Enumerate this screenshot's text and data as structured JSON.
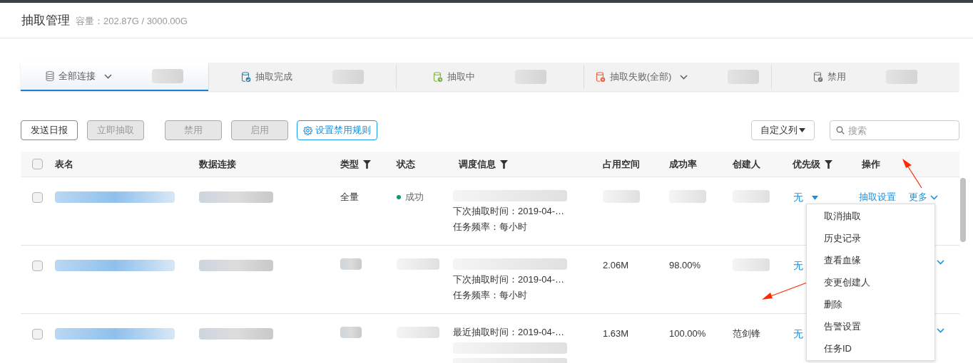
{
  "header": {
    "title": "抽取管理",
    "capacity": "容量：202.87G / 3000.00G"
  },
  "tabs": [
    {
      "label": "全部连接",
      "kind": "all",
      "dropdown": true,
      "selected": true
    },
    {
      "label": "抽取完成",
      "kind": "done",
      "dropdown": false,
      "selected": false
    },
    {
      "label": "抽取中",
      "kind": "running",
      "dropdown": false,
      "selected": false
    },
    {
      "label": "抽取失败(全部)",
      "kind": "failed",
      "dropdown": true,
      "selected": false
    },
    {
      "label": "禁用",
      "kind": "disabled",
      "dropdown": false,
      "selected": false
    }
  ],
  "toolbar": {
    "buttons": [
      {
        "label": "发送日报",
        "kind": "plain",
        "disabled": false
      },
      {
        "label": "立即抽取",
        "kind": "plain",
        "disabled": true
      },
      {
        "label": "禁用",
        "kind": "plain",
        "disabled": true
      },
      {
        "label": "启用",
        "kind": "plain",
        "disabled": true
      },
      {
        "label": "设置禁用规则",
        "kind": "settings",
        "disabled": false
      }
    ],
    "custom_columns": "自定义列",
    "search": {
      "placeholder": "搜索"
    }
  },
  "table": {
    "columns": [
      {
        "label": "表名",
        "filter": false
      },
      {
        "label": "数据连接",
        "filter": false
      },
      {
        "label": "类型",
        "filter": true
      },
      {
        "label": "状态",
        "filter": false
      },
      {
        "label": "调度信息",
        "filter": true
      },
      {
        "label": "占用空间",
        "filter": false
      },
      {
        "label": "成功率",
        "filter": false
      },
      {
        "label": "创建人",
        "filter": false
      },
      {
        "label": "优先级",
        "filter": true
      },
      {
        "label": "操作",
        "filter": false
      }
    ],
    "rows": [
      {
        "checked": false,
        "type": "全量",
        "status": "成功",
        "schedule": [
          {
            "kind": "blurred"
          },
          {
            "kind": "text",
            "text": "下次抽取时间：2019-04-…"
          },
          {
            "kind": "text",
            "text": "任务频率：每小时"
          }
        ],
        "priority": "无",
        "priority_caret": true,
        "actions": [
          "抽取设置",
          "更多"
        ],
        "menu_open": true
      },
      {
        "checked": false,
        "schedule": [
          {
            "kind": "blurred"
          },
          {
            "kind": "text",
            "text": "下次抽取时间：2019-04-…"
          },
          {
            "kind": "text",
            "text": "任务频率：每小时"
          }
        ],
        "size": "2.06M",
        "success_rate": "98.00%",
        "priority": "无",
        "priority_caret": false,
        "menu_open": false
      },
      {
        "checked": false,
        "schedule": [
          {
            "kind": "text",
            "text": "最近抽取时间：2019-04-…"
          },
          {
            "kind": "blurred"
          },
          {
            "kind": "blurred"
          }
        ],
        "size": "1.63M",
        "success_rate": "100.00%",
        "creator": "范剑锋",
        "priority": "无",
        "priority_caret": false,
        "menu_open": false
      }
    ],
    "all_checked": false
  },
  "more_menu": [
    "取消抽取",
    "历史记录",
    "查看血缘",
    "变更创建人",
    "删除",
    "告警设置",
    "任务ID"
  ]
}
